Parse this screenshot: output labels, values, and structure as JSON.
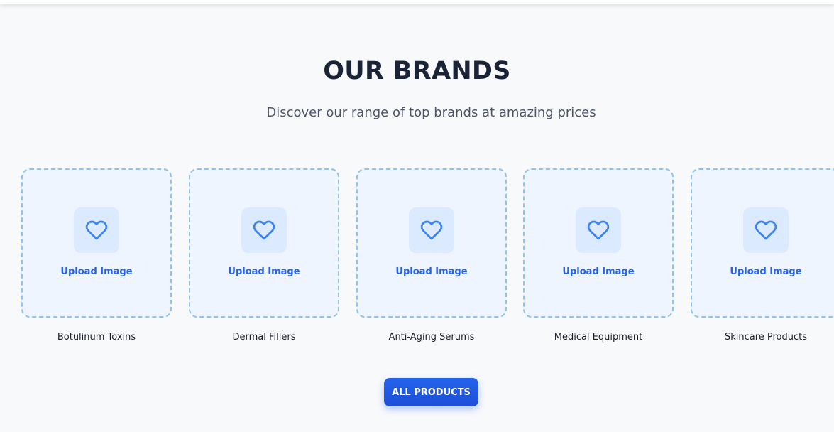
{
  "section": {
    "title": "OUR BRANDS",
    "subtitle": "Discover our range of top brands at amazing prices"
  },
  "brands": [
    {
      "name": "Botulinum Toxins",
      "upload_label": "Upload Image",
      "icon": "heart-icon"
    },
    {
      "name": "Dermal Fillers",
      "upload_label": "Upload Image",
      "icon": "heart-icon"
    },
    {
      "name": "Anti-Aging Serums",
      "upload_label": "Upload Image",
      "icon": "heart-icon"
    },
    {
      "name": "Medical Equipment",
      "upload_label": "Upload Image",
      "icon": "heart-icon"
    },
    {
      "name": "Skincare Products",
      "upload_label": "Upload Image",
      "icon": "heart-icon"
    }
  ],
  "cta": {
    "label": "ALL PRODUCTS"
  },
  "colors": {
    "accent": "#2563eb",
    "upload_border": "#90c4ef",
    "upload_bg": "#eef5ff",
    "icon_bg": "#dbeafe",
    "heading": "#1a2436",
    "background": "#f8f9fb"
  }
}
